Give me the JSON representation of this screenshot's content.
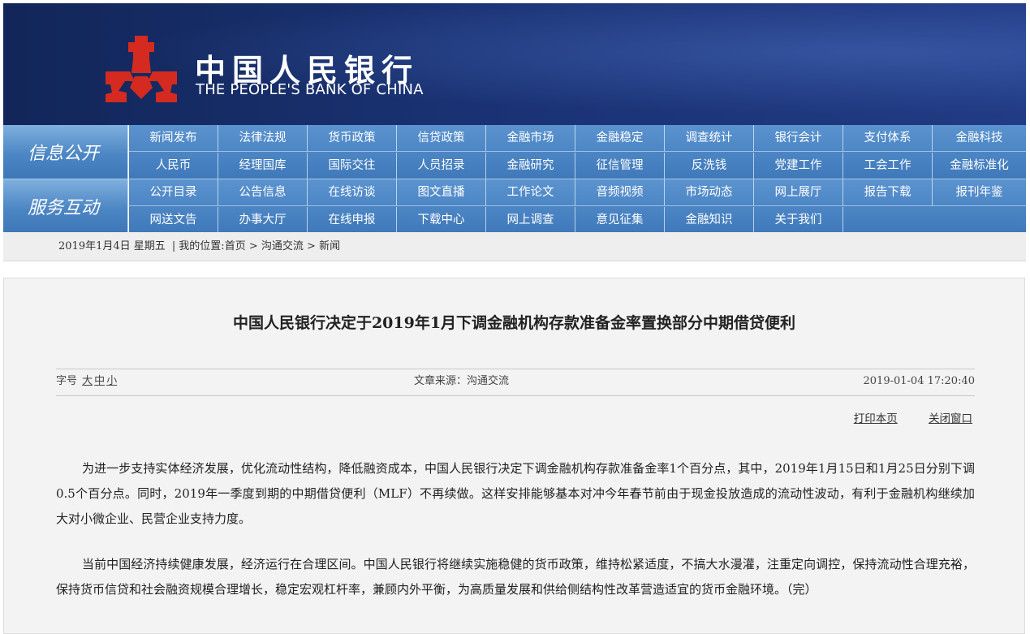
{
  "header": {
    "logo_cn": "中国人民银行",
    "logo_en": "THE PEOPLE'S BANK OF CHINA",
    "emblem_icon": "pboc-emblem-icon",
    "colors": {
      "banner": "#1a3273",
      "emblem_red": "#d42a20",
      "nav": "#3f79ba"
    }
  },
  "nav": {
    "info_title": "信息公开",
    "service_title": "服务互动",
    "info_row1": [
      "新闻发布",
      "法律法规",
      "货币政策",
      "信贷政策",
      "金融市场",
      "金融稳定",
      "调查统计",
      "银行会计",
      "支付体系",
      "金融科技"
    ],
    "info_row2": [
      "人民币",
      "经理国库",
      "国际交往",
      "人员招录",
      "金融研究",
      "征信管理",
      "反洗钱",
      "党建工作",
      "工会工作",
      "金融标准化"
    ],
    "service_row1": [
      "公开目录",
      "公告信息",
      "在线访谈",
      "图文直播",
      "工作论文",
      "音频视频",
      "市场动态",
      "网上展厅",
      "报告下载",
      "报刊年鉴"
    ],
    "service_row2": [
      "网送文告",
      "办事大厅",
      "在线申报",
      "下载中心",
      "网上调查",
      "意见征集",
      "金融知识",
      "关于我们"
    ]
  },
  "breadcrumb": {
    "date": "2019年1月4日 星期五",
    "separator": "|",
    "location_label": "我的位置:",
    "items": [
      "首页",
      "沟通交流",
      "新闻"
    ],
    "arrow": ">"
  },
  "article": {
    "title": "中国人民银行决定于2019年1月下调金融机构存款准备金率置换部分中期借贷便利",
    "font_size_label": "字号",
    "font_sizes": [
      "大",
      "中",
      "小"
    ],
    "source": "文章来源：沟通交流",
    "datetime": "2019-01-04 17:20:40",
    "print_label": "打印本页",
    "close_label": "关闭窗口",
    "paragraphs": [
      "为进一步支持实体经济发展，优化流动性结构，降低融资成本，中国人民银行决定下调金融机构存款准备金率1个百分点，其中，2019年1月15日和1月25日分别下调0.5个百分点。同时，2019年一季度到期的中期借贷便利（MLF）不再续做。这样安排能够基本对冲今年春节前由于现金投放造成的流动性波动，有利于金融机构继续加大对小微企业、民营企业支持力度。",
      "当前中国经济持续健康发展，经济运行在合理区间。中国人民银行将继续实施稳健的货币政策，维持松紧适度，不搞大水漫灌，注重定向调控，保持流动性合理充裕，保持货币信贷和社会融资规模合理增长，稳定宏观杠杆率，兼顾内外平衡，为高质量发展和供给侧结构性改革营造适宜的货币金融环境。（完）"
    ]
  }
}
